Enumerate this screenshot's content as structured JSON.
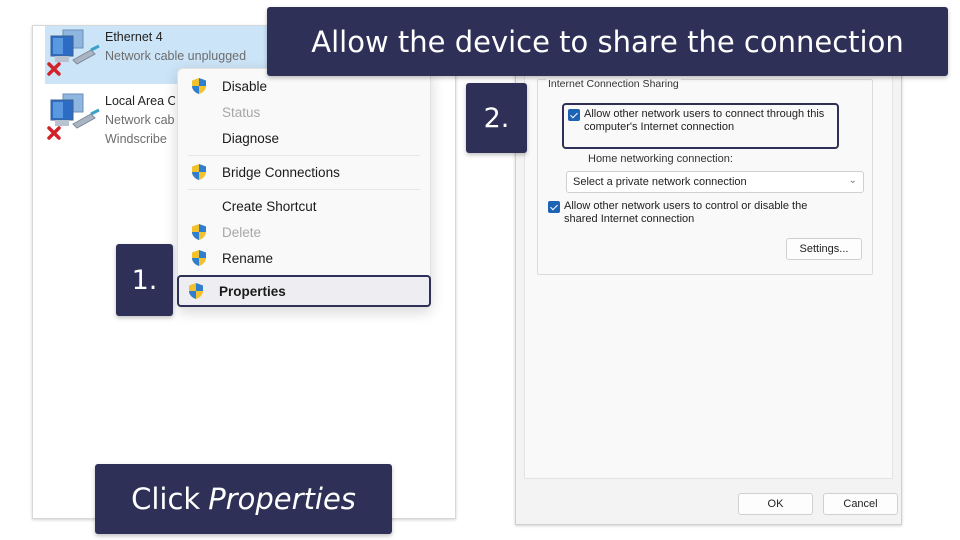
{
  "captions": {
    "title": "Allow the device to share the connection",
    "step1": "1.",
    "step2": "2.",
    "bottom_prefix": "Click",
    "bottom_emphasis": "Properties"
  },
  "adapters": [
    {
      "name": "Ethernet 4",
      "status": "Network cable unplugged",
      "device": "",
      "selected": true,
      "icon": "network-computer-disconnected-icon"
    },
    {
      "name": "Local Area Connection",
      "status": "Network cable unplugged",
      "device": "Windscribe",
      "selected": false,
      "icon": "network-computer-disconnected-icon"
    }
  ],
  "context_menu": {
    "items": [
      {
        "label": "Disable",
        "icon": "uac-shield-icon",
        "disabled": false
      },
      {
        "label": "Status",
        "icon": "",
        "disabled": true
      },
      {
        "label": "Diagnose",
        "icon": "",
        "disabled": false
      },
      {
        "label": "Bridge Connections",
        "icon": "uac-shield-icon",
        "disabled": false
      },
      {
        "label": "Create Shortcut",
        "icon": "",
        "disabled": false
      },
      {
        "label": "Delete",
        "icon": "uac-shield-icon",
        "disabled": true
      },
      {
        "label": "Rename",
        "icon": "uac-shield-icon",
        "disabled": false
      },
      {
        "label": "Properties",
        "icon": "uac-shield-icon",
        "disabled": false,
        "bold": true,
        "highlighted": true
      }
    ]
  },
  "dialog": {
    "group_title": "Internet Connection Sharing",
    "allow_connect": {
      "checked": true,
      "line1": "Allow other network users to connect through this",
      "line2": "computer's Internet connection"
    },
    "home_label": "Home networking connection:",
    "home_select": {
      "value": "Select a private network connection"
    },
    "allow_control": {
      "checked": true,
      "line1": "Allow other network users to control or disable the",
      "line2": "shared Internet connection"
    },
    "settings_button": "Settings...",
    "ok_button": "OK",
    "cancel_button": "Cancel"
  },
  "colors": {
    "callout_bg": "#2f3057",
    "selection": "#cce4f7",
    "checkbox": "#1f63b5"
  }
}
